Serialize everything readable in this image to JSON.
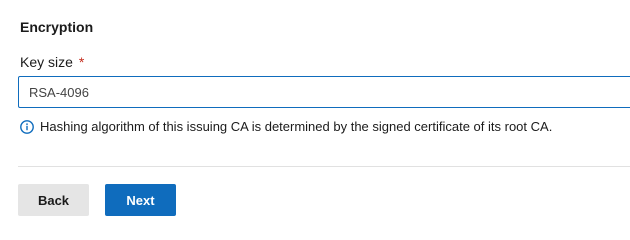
{
  "section": {
    "title": "Encryption"
  },
  "key_size": {
    "label": "Key size",
    "required_marker": "*",
    "value": "RSA-4096"
  },
  "info": {
    "icon": "info-icon",
    "text": "Hashing algorithm of this issuing CA is determined by the signed certificate of its root CA."
  },
  "actions": {
    "back_label": "Back",
    "next_label": "Next"
  },
  "colors": {
    "accent": "#0f6cbd",
    "required": "#c42b1c",
    "secondary_button": "#e5e5e5"
  }
}
